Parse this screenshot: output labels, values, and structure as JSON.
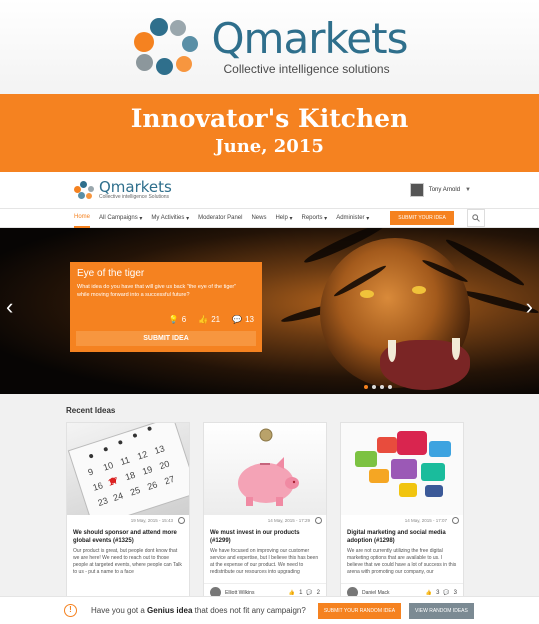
{
  "brand": {
    "name": "Qmarkets",
    "tagline": "Collective intelligence solutions"
  },
  "banner": {
    "title": "Innovator's Kitchen",
    "subtitle": "June, 2015"
  },
  "site": {
    "logo_name": "Qmarkets",
    "logo_tagline": "Collective intelligence Solutions",
    "user_name": "Tony Arnold",
    "nav": {
      "home": "Home",
      "all_campaigns": "All Campaigns",
      "my_activities": "My Activities",
      "moderator_panel": "Moderator Panel",
      "news": "News",
      "help": "Help",
      "reports": "Reports",
      "administer": "Administer",
      "submit_idea": "SUBMIT YOUR IDEA"
    }
  },
  "hero": {
    "title": "Eye of the tiger",
    "description": "What idea do you have that will give us back \"the eye of the tiger\" while moving forward into a successful future?",
    "ideas_count": "6",
    "likes_count": "21",
    "comments_count": "13",
    "button_label": "SUBMIT IDEA",
    "slides_active_index": 1
  },
  "recent": {
    "heading": "Recent Ideas",
    "cards": [
      {
        "date": "19 May, 2015 - 15:43",
        "title": "We should sponsor and attend more global events (#1325)",
        "body": "Our product is great, but people dont know that we are here! We need to reach out to those people at targeted events, where people can Talk to us - put a name to a face",
        "author": "",
        "likes": "",
        "comments": ""
      },
      {
        "date": "14 May, 2015 - 17:29",
        "title": "We must invest in our products (#1299)",
        "body": "We have focused on improving our customer service and expertise, but I believe this has been at the expense of our product. We need to redistribute our resources into upgrading",
        "author": "Elliott Wilkins",
        "likes": "1",
        "comments": "2"
      },
      {
        "date": "14 May, 2015 - 17:07",
        "title": "Digital marketing and social media adoption (#1298)",
        "body": "We are not currently utilizing the free digital marketing options that are available to us. I believe that we could have a lot of success in this arena with promoting our company, our",
        "author": "Daniel Mack",
        "likes": "3",
        "comments": "3"
      }
    ]
  },
  "genius": {
    "text_before": "Have you got a",
    "text_bold": "Genius idea",
    "text_after": "that does not fit any campaign?",
    "submit_random": "SUBMIT YOUR RANDOM IDEA",
    "view_random": "VIEW RANDOM IDEAS"
  },
  "colors": {
    "accent": "#f58220",
    "brand_blue": "#2f6f8c"
  }
}
